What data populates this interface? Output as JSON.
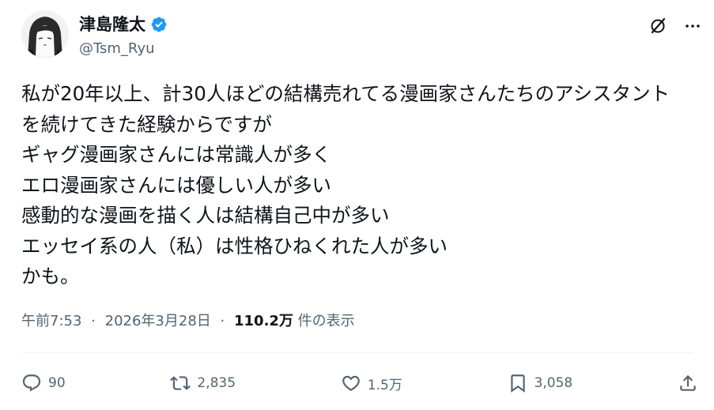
{
  "author": {
    "display_name": "津島隆太",
    "handle": "@Tsm_Ryu",
    "verified_icon": "verified-badge-icon",
    "badge_color": "#1d9bf0"
  },
  "top_actions": {
    "grok_icon": "grok-icon",
    "more_icon": "more-icon"
  },
  "tweet": {
    "lines": [
      "私が20年以上、計30人ほどの結構売れてる漫画家さんたちのアシスタント",
      "を続けてきた経験からですが",
      "ギャグ漫画家さんには常識人が多く",
      "エロ漫画家さんには優しい人が多い",
      "感動的な漫画を描く人は結構自己中が多い",
      "エッセイ系の人（私）は性格ひねくれた人が多い",
      "かも。"
    ]
  },
  "meta": {
    "time": "午前7:53",
    "separator": "·",
    "date": "2026年3月28日",
    "views_count": "110.2万",
    "views_label": "件の表示"
  },
  "actions": {
    "reply_count": "90",
    "retweet_count": "2,835",
    "like_count": "1.5万",
    "bookmark_count": "3,058"
  },
  "colors": {
    "text": "#0f1419",
    "secondary": "#536471",
    "accent": "#1d9bf0",
    "divider": "#eff3f4"
  }
}
